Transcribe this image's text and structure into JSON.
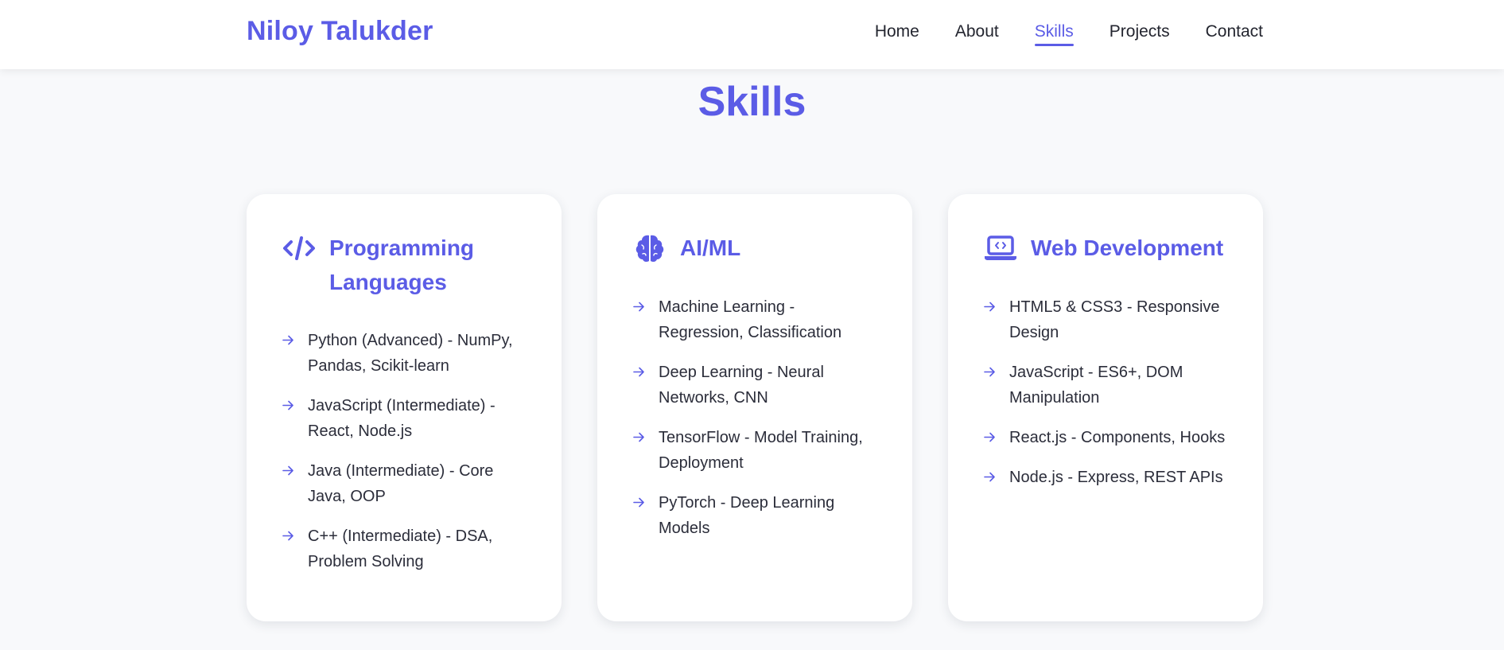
{
  "brand": "Niloy Talukder",
  "nav": [
    {
      "label": "Home",
      "active": false
    },
    {
      "label": "About",
      "active": false
    },
    {
      "label": "Skills",
      "active": true
    },
    {
      "label": "Projects",
      "active": false
    },
    {
      "label": "Contact",
      "active": false
    }
  ],
  "colors": {
    "accent": "#5b5ce6",
    "text": "#2b2d3a",
    "background": "#f8f9fb",
    "card": "#ffffff"
  },
  "section": {
    "title": "Skills"
  },
  "cards": [
    {
      "icon": "code-icon",
      "title": "Programming Languages",
      "items": [
        "Python (Advanced) - NumPy, Pandas, Scikit-learn",
        "JavaScript (Intermediate) - React, Node.js",
        "Java (Intermediate) - Core Java, OOP",
        "C++ (Intermediate) - DSA, Problem Solving"
      ]
    },
    {
      "icon": "brain-icon",
      "title": "AI/ML",
      "items": [
        "Machine Learning - Regression, Classification",
        "Deep Learning - Neural Networks, CNN",
        "TensorFlow - Model Training, Deployment",
        "PyTorch - Deep Learning Models"
      ]
    },
    {
      "icon": "laptop-code-icon",
      "title": "Web Development",
      "items": [
        "HTML5 & CSS3 - Responsive Design",
        "JavaScript - ES6+, DOM Manipulation",
        "React.js - Components, Hooks",
        "Node.js - Express, REST APIs"
      ]
    }
  ]
}
